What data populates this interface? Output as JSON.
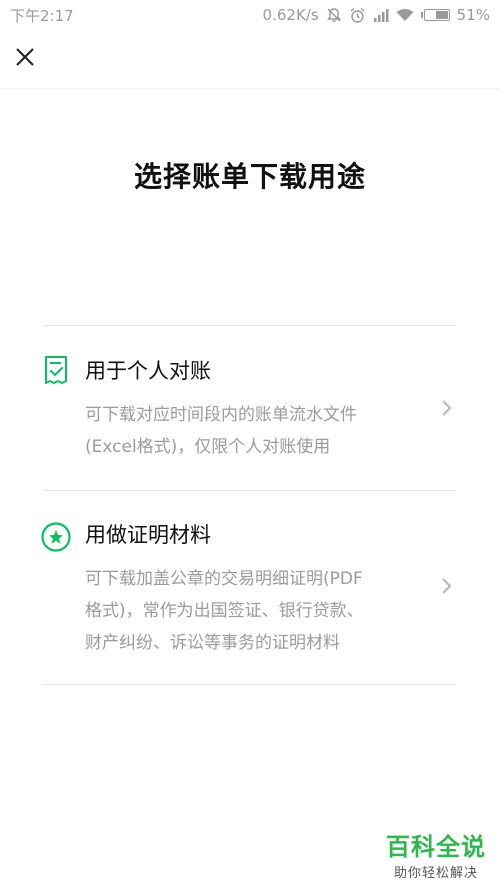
{
  "status_bar": {
    "time": "下午2:17",
    "net_speed": "0.62K/s",
    "battery": "51%",
    "battery_level": 0.51,
    "icons": [
      "mute-icon",
      "alarm-icon",
      "signal-icon",
      "wifi-icon",
      "battery-icon"
    ]
  },
  "header": {
    "close_icon": "close-icon"
  },
  "title": "选择账单下载用途",
  "options": [
    {
      "icon": "document-check-icon",
      "title": "用于个人对账",
      "desc_lines": [
        "可下载对应时间段内的账单流水文件",
        "(Excel格式)，仅限个人对账使用"
      ]
    },
    {
      "icon": "star-badge-icon",
      "title": "用做证明材料",
      "desc_lines": [
        "可下载加盖公章的交易明细证明(PDF",
        "格式)，常作为出国签证、银行贷款、",
        "财产纠纷、诉讼等事务的证明材料"
      ]
    }
  ],
  "colors": {
    "accent": "#07c160",
    "title_text": "#111111",
    "secondary_text": "#9b9b9b",
    "divider": "#e6e6e6"
  },
  "watermark": {
    "title": "百科全说",
    "subtitle": "助你轻松解决"
  }
}
